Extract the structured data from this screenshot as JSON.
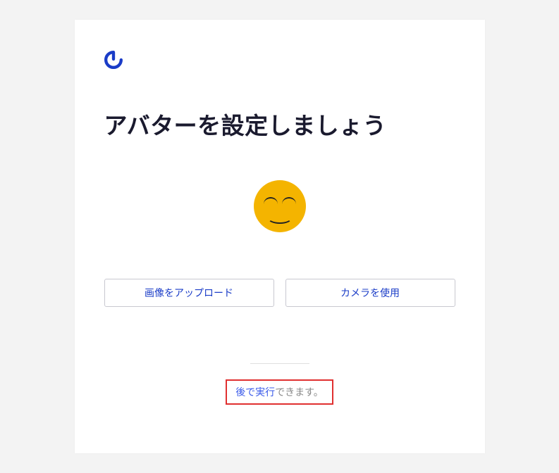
{
  "logo": {
    "name": "gravatar-logo"
  },
  "title": "アバターを設定しましょう",
  "avatar": {
    "name": "smiley-avatar"
  },
  "buttons": {
    "upload": "画像をアップロード",
    "camera": "カメラを使用"
  },
  "skip": {
    "action": "後で実行",
    "rest": "できます。"
  },
  "colors": {
    "accent": "#1a3cc7",
    "link": "#3858e9",
    "highlight_border": "#e03030",
    "avatar_bg": "#f4b400"
  }
}
